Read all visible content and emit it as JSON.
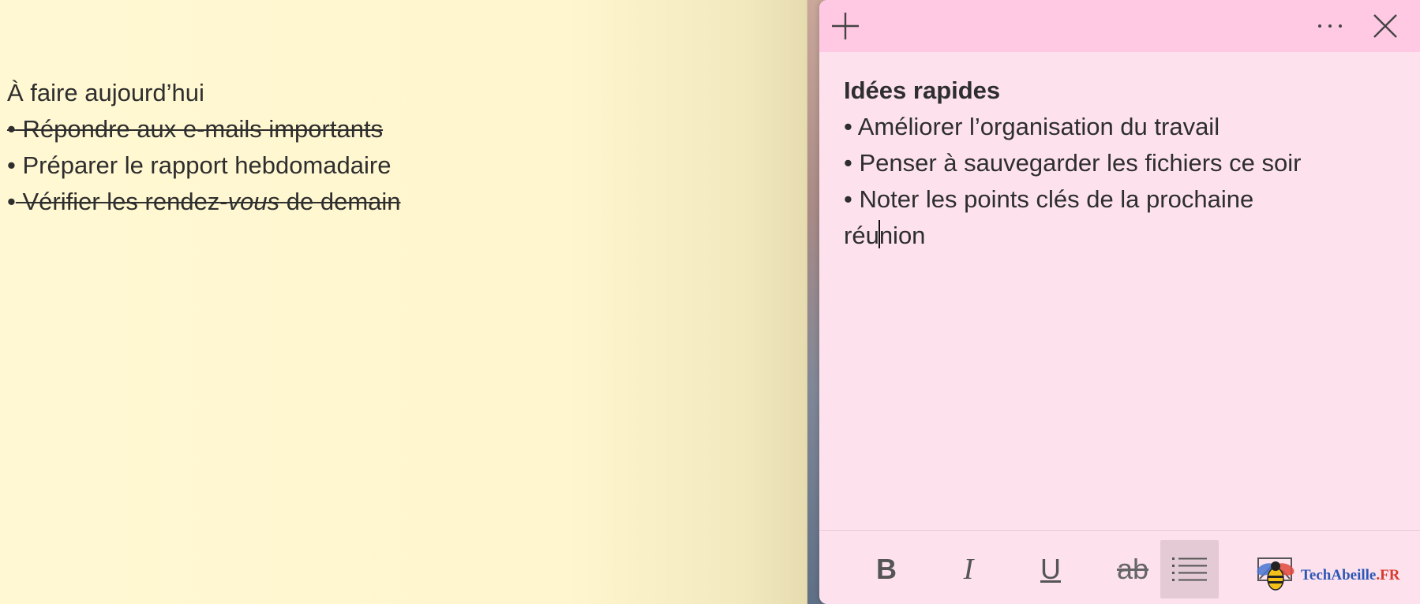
{
  "yellow_note": {
    "lines": [
      {
        "text": "À faire aujourd’hui"
      },
      {
        "bullet": "•",
        "text": " Répondre aux e-mails importants"
      },
      {
        "bullet": "•",
        "text": " Préparer le rapport hebdomadaire"
      },
      {
        "bullet": "•",
        "text_a": " Vérifier les rendez-",
        "text_b": "vous",
        "text_c": " de demain"
      }
    ]
  },
  "pink_note": {
    "title": "Idées rapides",
    "lines": [
      "• Améliorer l’organisation du travail",
      "• Penser à sauvegarder les fichiers ce soir",
      "• Noter les points clés de la prochaine"
    ],
    "last_line_before_caret": "réu",
    "last_line_after_caret": "nion",
    "toolbar": {
      "bold": "B",
      "italic": "I",
      "underline": "U",
      "strikethrough": "ab"
    },
    "colors": {
      "titlebar": "#ffc9e3",
      "body": "#fde2ee",
      "yellow_body": "#fff8d2"
    }
  },
  "watermark": {
    "brand": "TechAbeille",
    "suffix": ".FR"
  }
}
